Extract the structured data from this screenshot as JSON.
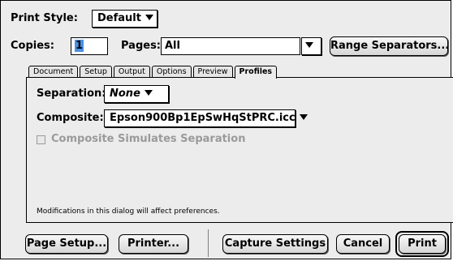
{
  "print_style": {
    "label": "Print Style:",
    "value": "Default"
  },
  "copies": {
    "label": "Copies:",
    "value": "1"
  },
  "pages": {
    "label": "Pages:",
    "value": "All"
  },
  "range_separators_label": "Range Separators...",
  "tabs": [
    {
      "label": "Document"
    },
    {
      "label": "Setup"
    },
    {
      "label": "Output"
    },
    {
      "label": "Options"
    },
    {
      "label": "Preview"
    },
    {
      "label": "Profiles"
    }
  ],
  "active_tab": "Profiles",
  "separation": {
    "label": "Separation:",
    "value": "None"
  },
  "composite": {
    "label": "Composite:",
    "value": "Epson900Bp1EpSwHqStPRC.icc"
  },
  "composite_simulates_label": "Composite Simulates Separation",
  "note": "Modifications in this dialog will affect preferences.",
  "buttons": {
    "page_setup": "Page Setup...",
    "printer": "Printer...",
    "capture_settings": "Capture Settings",
    "cancel": "Cancel",
    "print": "Print"
  },
  "colors": {
    "copies_highlight": "#4a90e2",
    "dialog_bg": "#ececec"
  }
}
